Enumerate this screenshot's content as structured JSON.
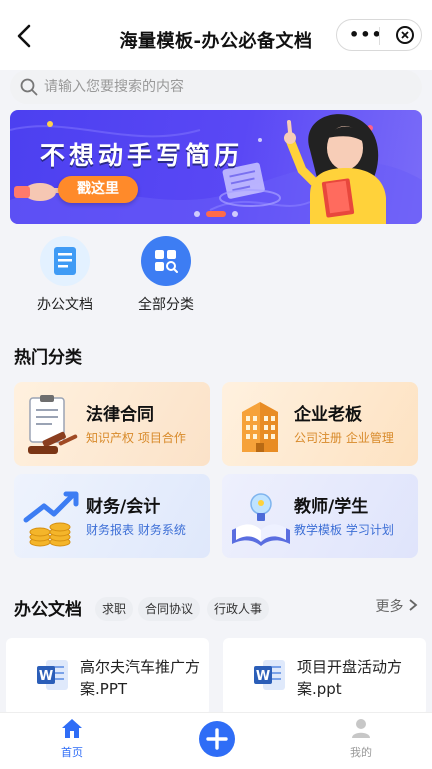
{
  "header": {
    "title": "海量模板-办公必备文档"
  },
  "search": {
    "placeholder": "请输入您要搜索的内容"
  },
  "banner": {
    "headline": "不想动手写简历",
    "cta": "戳这里"
  },
  "quick_actions": [
    {
      "label": "办公文档",
      "icon": "document-icon"
    },
    {
      "label": "全部分类",
      "icon": "category-search-icon"
    }
  ],
  "hot_section": {
    "title": "热门分类"
  },
  "categories": [
    {
      "name": "法律合同",
      "sub": "知识产权 项目合作",
      "icon": "gavel-contract-icon",
      "color": "#fbe6cf"
    },
    {
      "name": "企业老板",
      "sub": "公司注册 企业管理",
      "icon": "building-icon",
      "color": "#fde7cd"
    },
    {
      "name": "财务/会计",
      "sub": "财务报表 财务系统",
      "icon": "coins-chart-icon",
      "color": "#e4ecfb"
    },
    {
      "name": "教师/学生",
      "sub": "教学模板 学习计划",
      "icon": "book-bulb-icon",
      "color": "#e4e8fb"
    }
  ],
  "docs": {
    "title": "办公文档",
    "chips": [
      "求职",
      "合同协议",
      "行政人事"
    ],
    "more": "更多",
    "items": [
      {
        "name": "高尔夫汽车推广方案.PPT",
        "icon": "word-file-icon"
      },
      {
        "name": "项目开盘活动方案.ppt",
        "icon": "word-file-icon"
      }
    ]
  },
  "tabbar": {
    "home": "首页",
    "mine": "我的"
  },
  "colors": {
    "accent": "#2f6df6",
    "banner": "#4f43f2",
    "cta": "#ff8a2a"
  }
}
